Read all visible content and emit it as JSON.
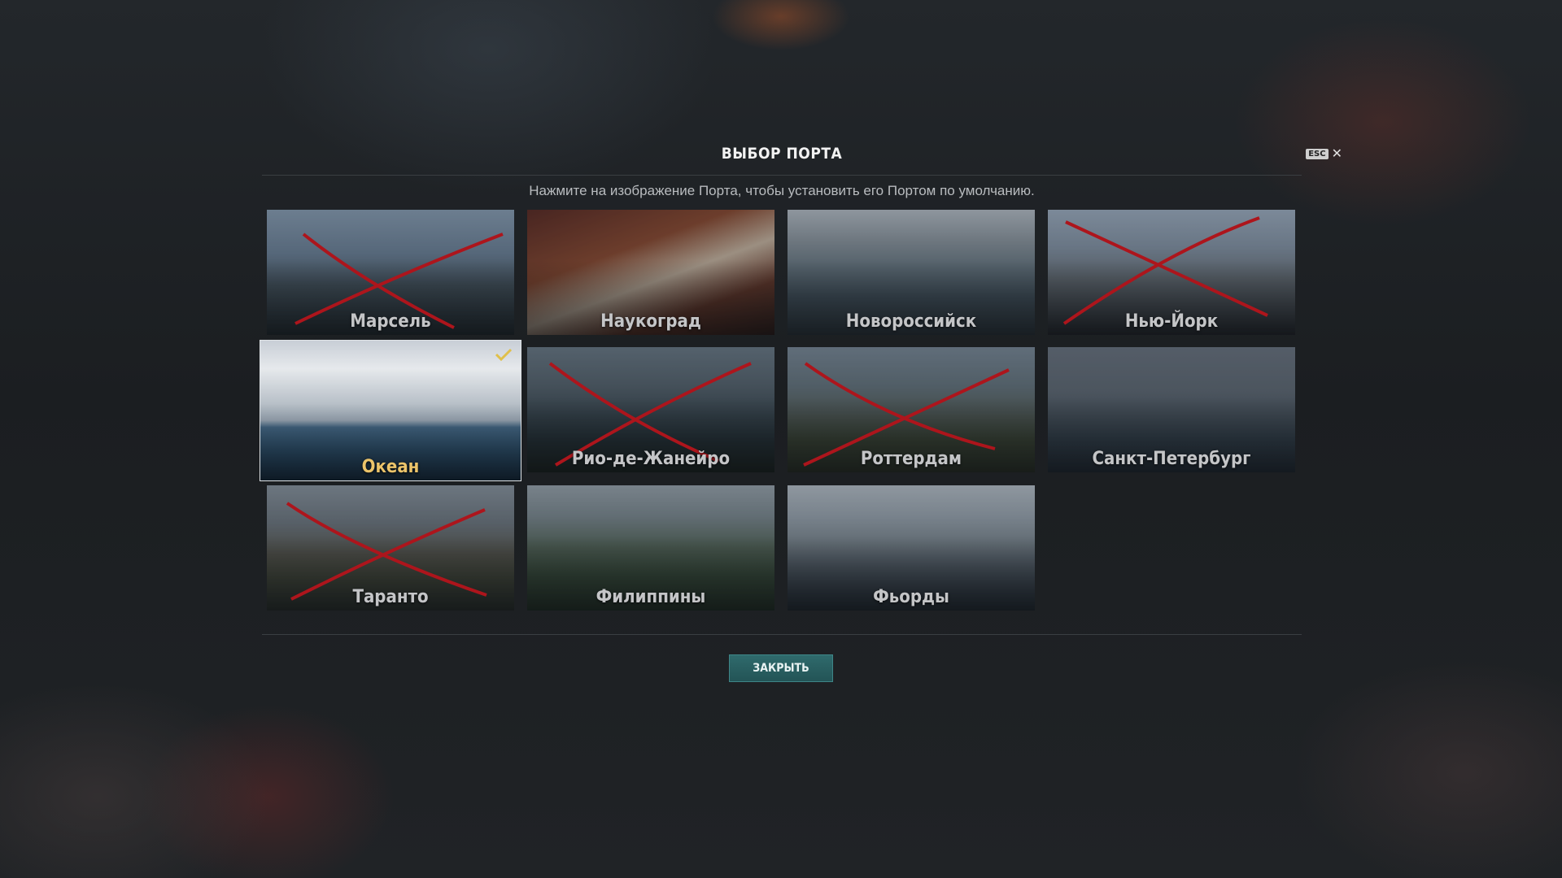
{
  "dialog": {
    "title": "ВЫБОР ПОРТА",
    "esc_key": "ESC",
    "close_glyph": "✕",
    "subtitle": "Нажмите на изображение Порта, чтобы установить его Портом по умолчанию.",
    "close_button": "ЗАКРЫТЬ"
  },
  "ports": [
    {
      "name": "Марсель",
      "crossed": true,
      "selected": false
    },
    {
      "name": "Наукоград",
      "crossed": false,
      "selected": false
    },
    {
      "name": "Новороссийск",
      "crossed": false,
      "selected": false
    },
    {
      "name": "Нью-Йорк",
      "crossed": true,
      "selected": false
    },
    {
      "name": "Океан",
      "crossed": false,
      "selected": true
    },
    {
      "name": "Рио-де-Жанейро",
      "crossed": true,
      "selected": false
    },
    {
      "name": "Роттердам",
      "crossed": true,
      "selected": false
    },
    {
      "name": "Санкт-Петербург",
      "crossed": false,
      "selected": false
    },
    {
      "name": "Таранто",
      "crossed": true,
      "selected": false
    },
    {
      "name": "Филиппины",
      "crossed": false,
      "selected": false
    },
    {
      "name": "Фьорды",
      "crossed": false,
      "selected": false
    }
  ],
  "colors": {
    "selected_label": "#ecc46a",
    "cross": "#e0151b",
    "close_button": "#2a6062"
  }
}
